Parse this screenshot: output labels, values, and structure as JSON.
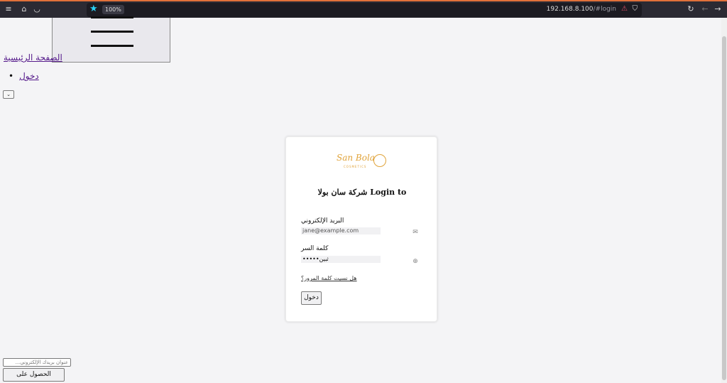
{
  "browser": {
    "zoom_level": "100%",
    "url_host": "192.168.8.100",
    "url_path": "/#login",
    "icons": [
      "menu-icon",
      "extensions-icon",
      "pocket-icon",
      "bookmark-star-icon",
      "lock-warning-icon",
      "tracking-shield-icon",
      "reload-icon",
      "back-icon",
      "forward-icon"
    ]
  },
  "nav": {
    "home_label": "الصفحة الرئيسية",
    "login_label": "دخول",
    "language_select_value": "⌄"
  },
  "login": {
    "logo_text": "San Bola",
    "logo_sub": "COSMETICS",
    "title": "شركة سان بولا Login to",
    "email_label": "البريد الإلكتروني",
    "email_placeholder": "jane@example.com",
    "password_label": "كلمة السر",
    "password_value": "•••••ثبين",
    "forgot_label": "هل نسيت كلمة المرور؟",
    "submit_label": "دخول",
    "accent_color": "#e0a33a"
  },
  "newsletter": {
    "email_placeholder": "...عنوان بريدك الإلكتروني",
    "button_label": "الحصول على التحديثات"
  }
}
